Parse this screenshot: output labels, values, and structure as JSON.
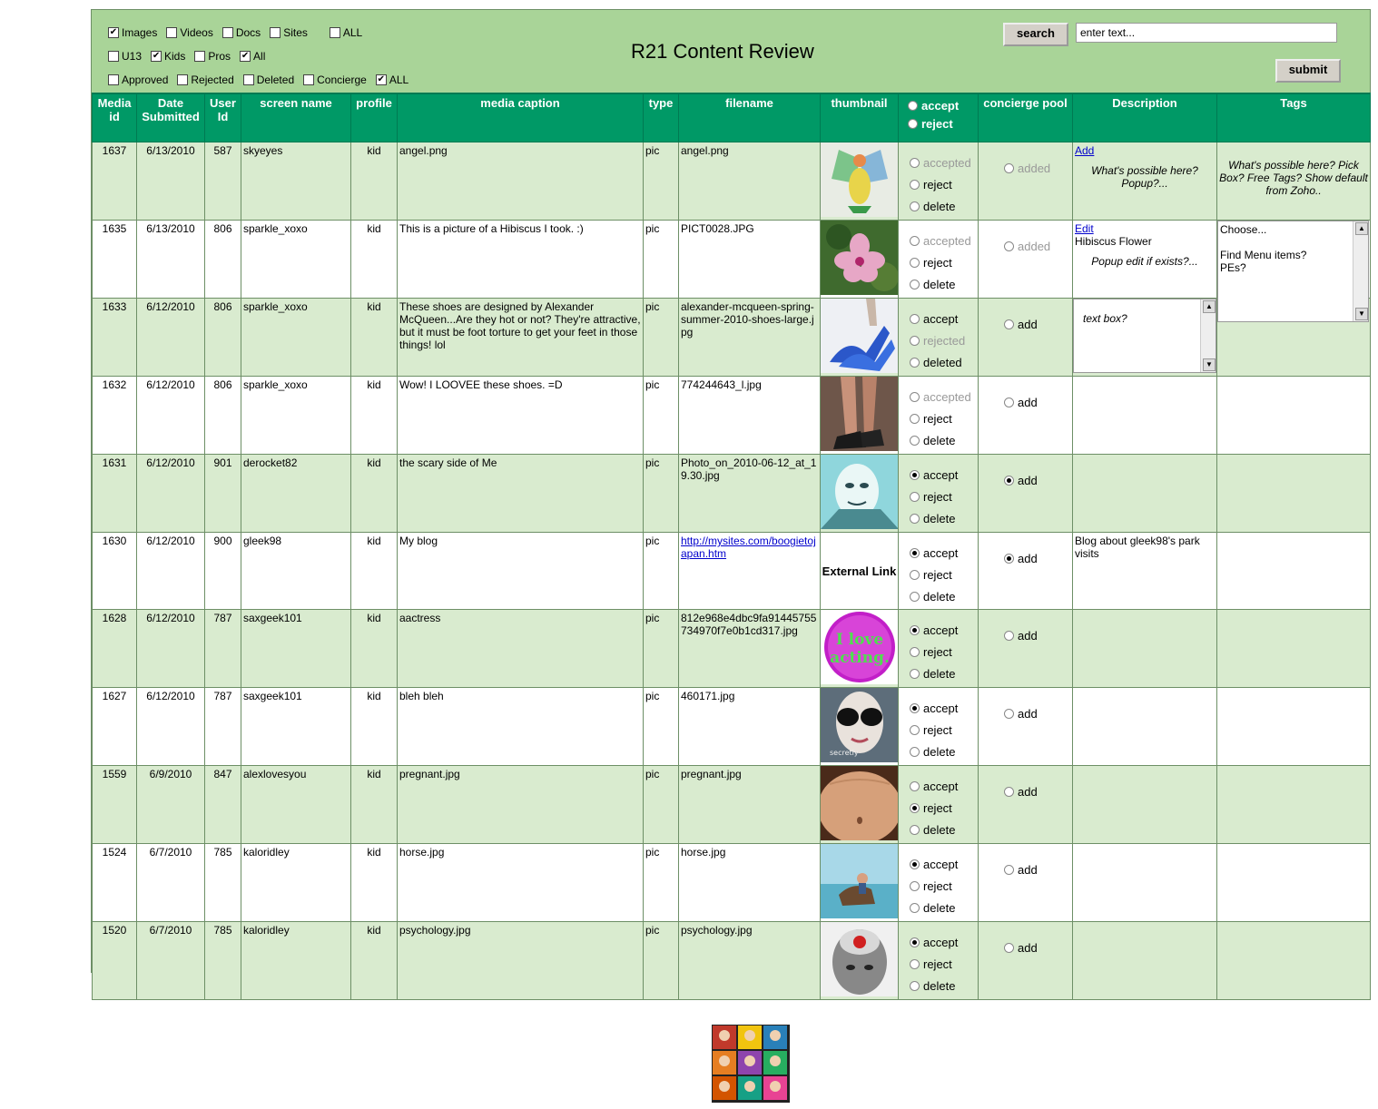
{
  "title": "R21 Content Review",
  "filters": {
    "row1": [
      {
        "label": "Images",
        "checked": true
      },
      {
        "label": "Videos",
        "checked": false
      },
      {
        "label": "Docs",
        "checked": false
      },
      {
        "label": "Sites",
        "checked": false
      },
      {
        "label": "ALL",
        "checked": false
      }
    ],
    "row2": [
      {
        "label": "U13",
        "checked": false
      },
      {
        "label": "Kids",
        "checked": true
      },
      {
        "label": "Pros",
        "checked": false
      },
      {
        "label": "All",
        "checked": true
      }
    ],
    "row3": [
      {
        "label": "Approved",
        "checked": false
      },
      {
        "label": "Rejected",
        "checked": false
      },
      {
        "label": "Deleted",
        "checked": false
      },
      {
        "label": "Concierge",
        "checked": false
      },
      {
        "label": "ALL",
        "checked": true
      }
    ]
  },
  "search": {
    "button": "search",
    "placeholder": "enter text..."
  },
  "submit": "submit",
  "columns": {
    "media_id": "Media id",
    "date": "Date Submitted",
    "user_id": "User Id",
    "screen_name": "screen name",
    "profile": "profile",
    "caption": "media caption",
    "type": "type",
    "filename": "filename",
    "thumbnail": "thumbnail",
    "accept": "accept",
    "reject": "reject",
    "concierge": "concierge pool",
    "description": "Description",
    "tags": "Tags"
  },
  "rows": [
    {
      "id": "1637",
      "date": "6/13/2010",
      "user": "587",
      "name": "skyeyes",
      "profile": "kid",
      "caption": "angel.png",
      "type": "pic",
      "filename": "angel.png",
      "thumb": "angel",
      "opts": [
        [
          "accepted",
          false,
          true
        ],
        [
          "reject",
          false,
          false
        ],
        [
          "delete",
          false,
          false
        ]
      ],
      "pool": [
        "added",
        false,
        true
      ],
      "desc_link": "Add",
      "desc_note": "What's possible here? Popup?...",
      "tags_note": "What's possible here? Pick Box? Free Tags? Show default from Zoho..",
      "style": "even"
    },
    {
      "id": "1635",
      "date": "6/13/2010",
      "user": "806",
      "name": "sparkle_xoxo",
      "profile": "kid",
      "caption": "This is a picture of a Hibiscus I took. :)",
      "type": "pic",
      "filename": "PICT0028.JPG",
      "thumb": "hibiscus",
      "opts": [
        [
          "accepted",
          false,
          true
        ],
        [
          "reject",
          false,
          false
        ],
        [
          "delete",
          false,
          false
        ]
      ],
      "pool": [
        "added",
        false,
        true
      ],
      "desc_link": "Edit",
      "desc_text": "Hibiscus Flower",
      "desc_note": "Popup edit if exists?...",
      "tags_box": "Choose...\n\nFind Menu items?\nPEs?",
      "style": "odd"
    },
    {
      "id": "1633",
      "date": "6/12/2010",
      "user": "806",
      "name": "sparkle_xoxo",
      "profile": "kid",
      "caption": "These shoes are designed by Alexander McQueen...Are they hot or not? They're attractive, but it must be foot torture to get your feet in those things! lol",
      "type": "pic",
      "filename": "alexander-mcqueen-spring-summer-2010-shoes-large.jpg",
      "thumb": "shoes",
      "opts": [
        [
          "accept",
          false,
          false
        ],
        [
          "rejected",
          false,
          true
        ],
        [
          "deleted",
          false,
          false
        ]
      ],
      "pool": [
        "add",
        false,
        false
      ],
      "desc_box": "text box?",
      "style": "even"
    },
    {
      "id": "1632",
      "date": "6/12/2010",
      "user": "806",
      "name": "sparkle_xoxo",
      "profile": "kid",
      "caption": "Wow! I LOOVEE these shoes. =D",
      "type": "pic",
      "filename": "774244643_l.jpg",
      "thumb": "heels",
      "opts": [
        [
          "accepted",
          false,
          true
        ],
        [
          "reject",
          false,
          false
        ],
        [
          "delete",
          false,
          false
        ]
      ],
      "pool": [
        "add",
        false,
        false
      ],
      "style": "odd"
    },
    {
      "id": "1631",
      "date": "6/12/2010",
      "user": "901",
      "name": "derocket82",
      "profile": "kid",
      "caption": "the scary side of Me",
      "type": "pic",
      "filename": "Photo_on_2010-06-12_at_19.30.jpg",
      "thumb": "face",
      "opts": [
        [
          "accept",
          true,
          false
        ],
        [
          "reject",
          false,
          false
        ],
        [
          "delete",
          false,
          false
        ]
      ],
      "pool": [
        "add",
        true,
        false
      ],
      "style": "even"
    },
    {
      "id": "1630",
      "date": "6/12/2010",
      "user": "900",
      "name": "gleek98",
      "profile": "kid",
      "caption": "My blog",
      "type": "pic",
      "filename": "http://mysites.com/boogietojapan.htm",
      "filename_link": true,
      "thumb": "external",
      "thumb_text": "External Link",
      "opts": [
        [
          "accept",
          true,
          false
        ],
        [
          "reject",
          false,
          false
        ],
        [
          "delete",
          false,
          false
        ]
      ],
      "pool": [
        "add",
        true,
        false
      ],
      "desc_text": "Blog about gleek98's park visits",
      "style": "odd"
    },
    {
      "id": "1628",
      "date": "6/12/2010",
      "user": "787",
      "name": "saxgeek101",
      "profile": "kid",
      "caption": "aactress",
      "type": "pic",
      "filename": "812e968e4dbc9fa91445755734970f7e0b1cd317.jpg",
      "thumb": "acting",
      "thumb_text": "I love acting.",
      "opts": [
        [
          "accept",
          true,
          false
        ],
        [
          "reject",
          false,
          false
        ],
        [
          "delete",
          false,
          false
        ]
      ],
      "pool": [
        "add",
        false,
        false
      ],
      "style": "even"
    },
    {
      "id": "1627",
      "date": "6/12/2010",
      "user": "787",
      "name": "saxgeek101",
      "profile": "kid",
      "caption": "bleh bleh",
      "type": "pic",
      "filename": "460171.jpg",
      "thumb": "sunglasses",
      "opts": [
        [
          "accept",
          true,
          false
        ],
        [
          "reject",
          false,
          false
        ],
        [
          "delete",
          false,
          false
        ]
      ],
      "pool": [
        "add",
        false,
        false
      ],
      "style": "odd"
    },
    {
      "id": "1559",
      "date": "6/9/2010",
      "user": "847",
      "name": "alexlovesyou",
      "profile": "kid",
      "caption": "pregnant.jpg",
      "type": "pic",
      "filename": "pregnant.jpg",
      "thumb": "belly",
      "opts": [
        [
          "accept",
          false,
          false
        ],
        [
          "reject",
          true,
          false
        ],
        [
          "delete",
          false,
          false
        ]
      ],
      "pool": [
        "add",
        false,
        false
      ],
      "style": "even"
    },
    {
      "id": "1524",
      "date": "6/7/2010",
      "user": "785",
      "name": "kaloridley",
      "profile": "kid",
      "caption": "horse.jpg",
      "type": "pic",
      "filename": "horse.jpg",
      "thumb": "horse",
      "opts": [
        [
          "accept",
          true,
          false
        ],
        [
          "reject",
          false,
          false
        ],
        [
          "delete",
          false,
          false
        ]
      ],
      "pool": [
        "add",
        false,
        false
      ],
      "style": "odd"
    },
    {
      "id": "1520",
      "date": "6/7/2010",
      "user": "785",
      "name": "kaloridley",
      "profile": "kid",
      "caption": "psychology.jpg",
      "type": "pic",
      "filename": "psychology.jpg",
      "thumb": "head",
      "opts": [
        [
          "accept",
          true,
          false
        ],
        [
          "reject",
          false,
          false
        ],
        [
          "delete",
          false,
          false
        ]
      ],
      "pool": [
        "add",
        false,
        false
      ],
      "style": "even"
    }
  ],
  "row_heights": [
    84,
    82,
    85,
    84,
    83,
    84,
    83,
    85,
    83,
    83,
    85
  ]
}
